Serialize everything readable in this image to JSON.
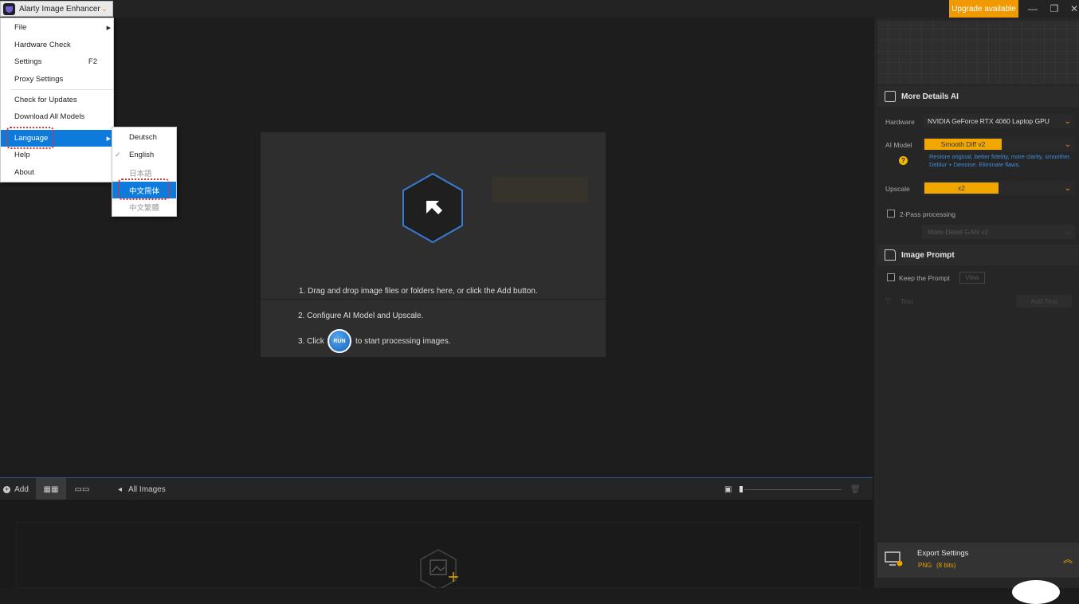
{
  "app": {
    "title": "Alarty Image Enhancer",
    "upgrade": "Upgrade available"
  },
  "menu": {
    "items": [
      {
        "label": "File",
        "submenu": true
      },
      {
        "label": "Hardware Check"
      },
      {
        "label": "Settings",
        "shortcut": "F2"
      },
      {
        "label": "Proxy Settings"
      },
      {
        "label": "Check for Updates"
      },
      {
        "label": "Download All Models"
      },
      {
        "label": "Language",
        "submenu": true,
        "selected": true
      },
      {
        "label": "Help"
      },
      {
        "label": "About"
      }
    ],
    "language_submenu": [
      {
        "label": "Deutsch"
      },
      {
        "label": "English",
        "checked": true
      },
      {
        "label": "日本語",
        "disabled": true
      },
      {
        "label": "中文简体",
        "selected": true
      },
      {
        "label": "中文繁體",
        "disabled": true
      }
    ]
  },
  "steps": {
    "s1": "1. Drag and drop image files or folders here, or click the Add button.",
    "s2": "2. Configure AI Model and Upscale.",
    "s3a": "3. Click",
    "run": "RUN",
    "s3b": "to start processing images."
  },
  "bottombar": {
    "add": "Add",
    "all_images": "All Images"
  },
  "right": {
    "section1": "More Details AI",
    "hardware_label": "Hardware",
    "hardware_value": "NVIDIA GeForce RTX 4060 Laptop GPU",
    "model_label": "AI Model",
    "model_value": "Smooth Diff v2",
    "model_desc": "Restore original, better fidelity, more clarity, smoother. Deblur + Denoise. Eliminate flaws.",
    "upscale_label": "Upscale",
    "upscale_value": "x2",
    "twopass_label": "2-Pass processing",
    "twopass_model": "More-Detail GAN v2",
    "section2": "Image Prompt",
    "keep_prompt": "Keep the Prompt",
    "view": "View",
    "text_label": "Text",
    "add_text": "Add Text",
    "export_title": "Export Settings",
    "export_format": "PNG",
    "export_bits": "(8 bits)"
  },
  "colors": {
    "accent": "#f09900",
    "selection": "#0e7bdc",
    "highlight": "#e03030",
    "hex_border": "#3a7bd5"
  }
}
